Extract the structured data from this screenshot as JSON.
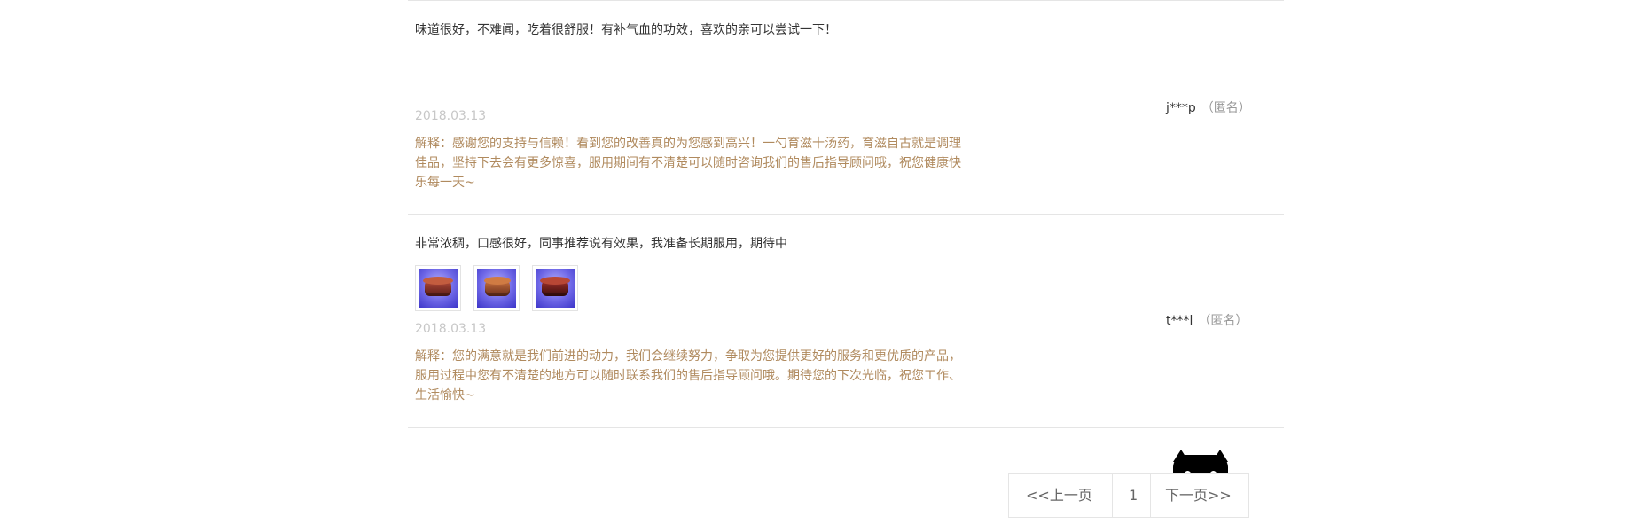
{
  "reviews": [
    {
      "text": "味道很好，不难闻，吃着很舒服！有补气血的功效，喜欢的亲可以尝试一下！",
      "date": "2018.03.13",
      "reply": "解释：感谢您的支持与信赖！看到您的改善真的为您感到高兴！一勺育滋十汤药，育滋自古就是调理佳品，坚持下去会有更多惊喜，服用期间有不清楚可以随时咨询我们的售后指导顾问哦，祝您健康快乐每一天~",
      "user": "j***p",
      "anon": "（匿名）"
    },
    {
      "text": "非常浓稠，口感很好，同事推荐说有效果，我准备长期服用，期待中",
      "date": "2018.03.13",
      "reply": "解释：您的满意就是我们前进的动力，我们会继续努力，争取为您提供更好的服务和更优质的产品，服用过程中您有不清楚的地方可以随时联系我们的售后指导顾问哦。期待您的下次光临，祝您工作、生活愉快~",
      "user": "t***l",
      "anon": "（匿名）",
      "photos": [
        "product-photo-1",
        "product-photo-2",
        "product-photo-3"
      ]
    }
  ],
  "pager": {
    "prev": "<<上一页",
    "current": "1",
    "next": "下一页>>"
  },
  "mascot": {
    "icon": "tmall-cat-icon"
  }
}
